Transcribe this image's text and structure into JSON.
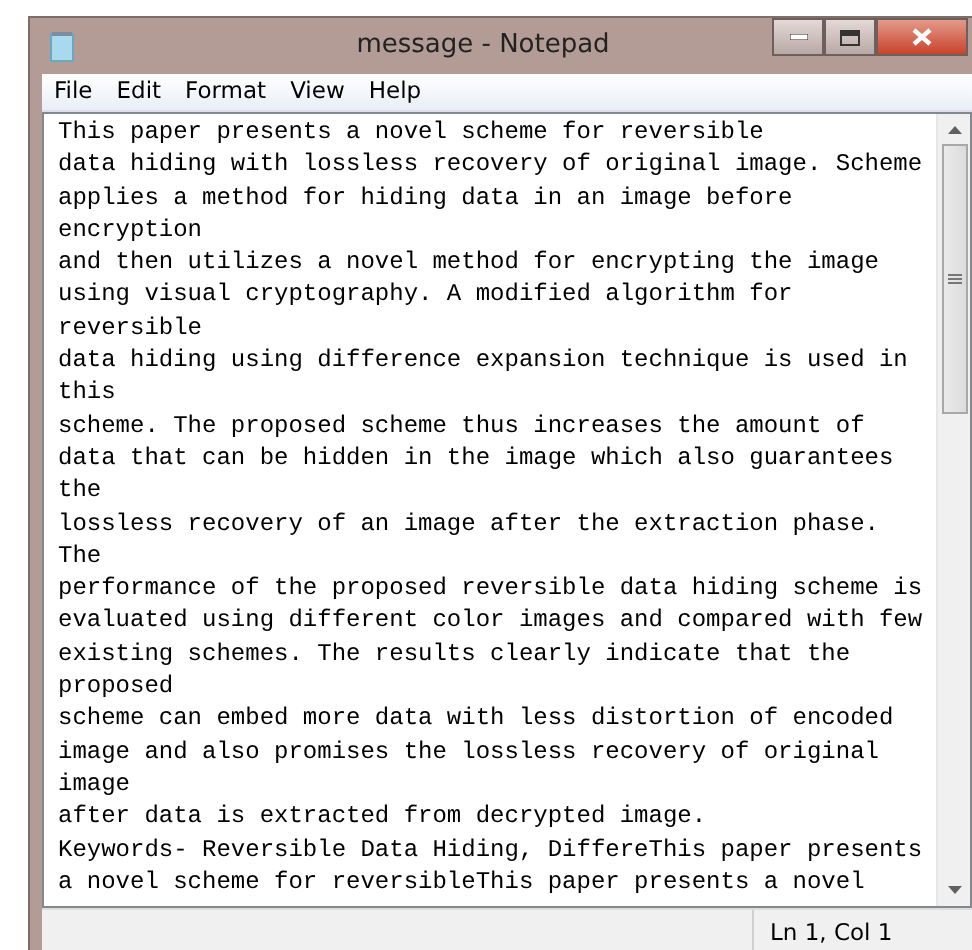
{
  "window": {
    "title": "message - Notepad"
  },
  "menu": [
    "File",
    "Edit",
    "Format",
    "View",
    "Help"
  ],
  "editor": {
    "lines": [
      "This paper presents a novel scheme for reversible",
      "data hiding with lossless recovery of original image. Scheme",
      "applies a method for hiding data in an image before",
      "encryption",
      "and then utilizes a novel method for encrypting the image",
      "using visual cryptography. A modified algorithm for",
      "reversible",
      "data hiding using difference expansion technique is used in",
      "this",
      "scheme. The proposed scheme thus increases the amount of",
      "data that can be hidden in the image which also guarantees",
      "the",
      "lossless recovery of an image after the extraction phase.",
      "The",
      "performance of the proposed reversible data hiding scheme is",
      "evaluated using different color images and compared with few",
      "existing schemes. The results clearly indicate that the",
      "proposed",
      "scheme can embed more data with less distortion of encoded",
      "image and also promises the lossless recovery of original",
      "image",
      "after data is extracted from decrypted image.",
      "Keywords- Reversible Data Hiding, DiffereThis paper presents",
      "a novel scheme for reversibleThis paper presents a novel"
    ]
  },
  "status_bar": {
    "position": "Ln 1, Col 1"
  }
}
